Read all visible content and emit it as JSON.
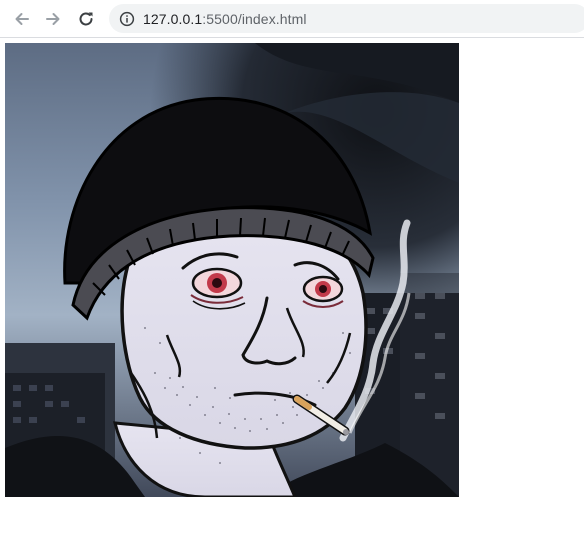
{
  "browser": {
    "url_host": "127.0.0.1",
    "url_rest": ":5500/index.html",
    "icons": {
      "back": "arrow-left-icon",
      "forward": "arrow-right-icon",
      "reload": "reload-icon",
      "site_info": "info-icon"
    },
    "colors": {
      "toolbar_bg": "#ffffff",
      "omnibox_bg": "#f1f3f4",
      "icon": "#5f6368",
      "icon_disabled": "#bdc1c6"
    }
  },
  "page": {
    "image": {
      "description_icon": "doomer-wojak-image"
    }
  }
}
